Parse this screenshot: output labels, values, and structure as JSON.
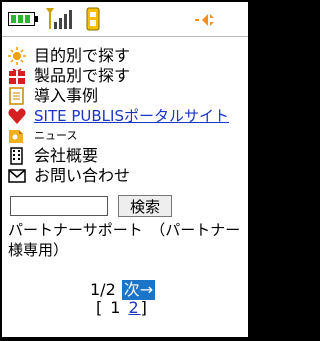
{
  "menu": {
    "items": [
      {
        "label": "目的別で探す"
      },
      {
        "label": "製品別で探す"
      },
      {
        "label": "導入事例"
      },
      {
        "label": "SITE PUBLISポータルサイト"
      },
      {
        "label": "ニュース"
      },
      {
        "label": "会社概要"
      },
      {
        "label": "お問い合わせ"
      }
    ]
  },
  "search": {
    "input_value": "",
    "button_label": "検索"
  },
  "support": {
    "text": "パートナーサポート　（パートナー様専用）"
  },
  "pager": {
    "page_indicator": "1/2",
    "next_label": "次→",
    "open_bracket": "[",
    "current_page": "1",
    "page2": "2",
    "close_bracket": "]"
  },
  "colors": {
    "link": "#1a35c8",
    "highlight": "#1a74c8",
    "battery_green": "#2db52d",
    "signal": "#caa000",
    "icon_red": "#d42020"
  }
}
